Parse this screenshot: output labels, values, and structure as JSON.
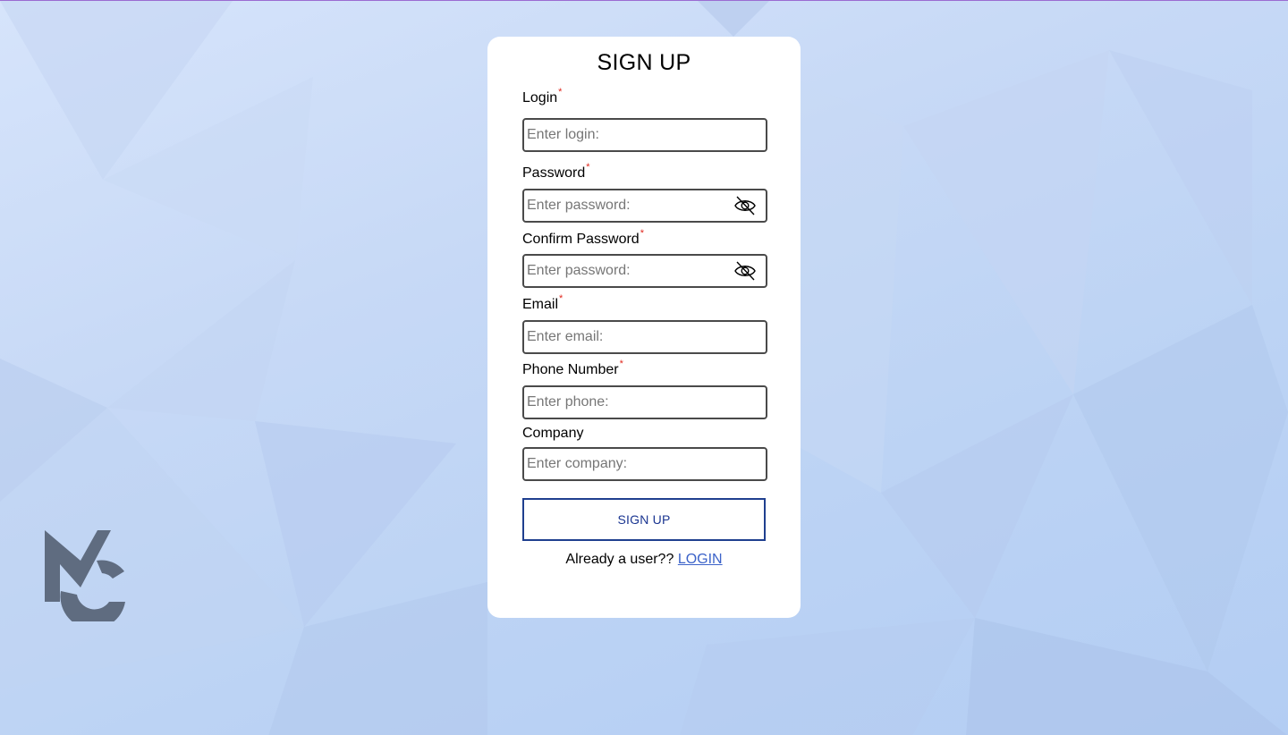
{
  "form": {
    "title": "SIGN UP",
    "fields": [
      {
        "label": "Login",
        "required_mark": "*",
        "placeholder": "Enter login:",
        "value": ""
      },
      {
        "label": "Password",
        "required_mark": "*",
        "placeholder": "Enter password:",
        "value": ""
      },
      {
        "label": "Confirm Password",
        "required_mark": "*",
        "placeholder": "Enter password:",
        "value": ""
      },
      {
        "label": "Email",
        "required_mark": "*",
        "placeholder": "Enter email:",
        "value": ""
      },
      {
        "label": "Phone Number",
        "required_mark": "*",
        "placeholder": "Enter phone:",
        "value": ""
      },
      {
        "label": "Company",
        "placeholder": "Enter company:",
        "value": ""
      }
    ],
    "submit_label": "SIGN UP",
    "footer_text": "Already a user??",
    "login_link": "LOGIN"
  },
  "icons": {
    "password_toggle": "eye-slash-icon",
    "logo": "mc-logo"
  },
  "colors": {
    "required": "#e0281e",
    "button_border": "#1f3f8f",
    "button_text": "#1a3591",
    "link": "#3c63c9",
    "logo": "#5f6c80"
  }
}
